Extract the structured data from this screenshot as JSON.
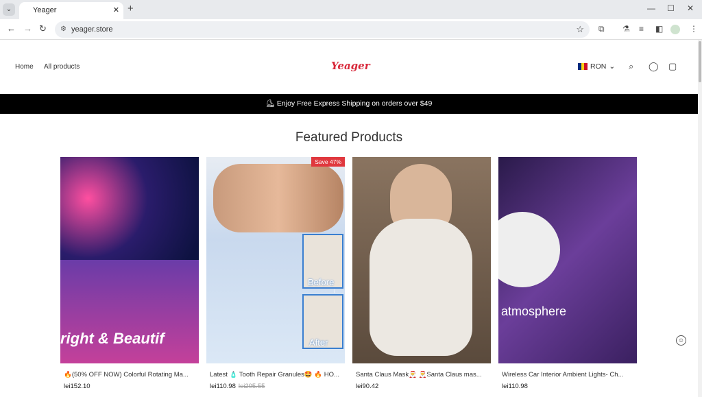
{
  "browser": {
    "tab_title": "Yeager",
    "url": "yeager.store"
  },
  "header": {
    "nav": [
      "Home",
      "All products"
    ],
    "logo": "Yeager",
    "currency": "RON",
    "brand_color": "#d8283a"
  },
  "banner": "⛸ Enjoy Free Express Shipping on orders over $49",
  "section_title": "Featured Products",
  "products": [
    {
      "name": "🔥(50% OFF NOW) Colorful Rotating Ma...",
      "price": "lei152.10",
      "image_text": "right & Beautif"
    },
    {
      "name": "Latest 🧴 Tooth Repair Granules🤩 🔥 HO...",
      "price": "lei110.98",
      "compare_price": "lei205.55",
      "badge": "Save 47%",
      "image_text": "Before / After"
    },
    {
      "name": "Santa Claus Mask🎅 🎅Santa Claus mas...",
      "price": "lei90.42"
    },
    {
      "name": "Wireless Car Interior Ambient Lights- Ch...",
      "price": "lei110.98",
      "image_text": "atmosphere"
    }
  ]
}
